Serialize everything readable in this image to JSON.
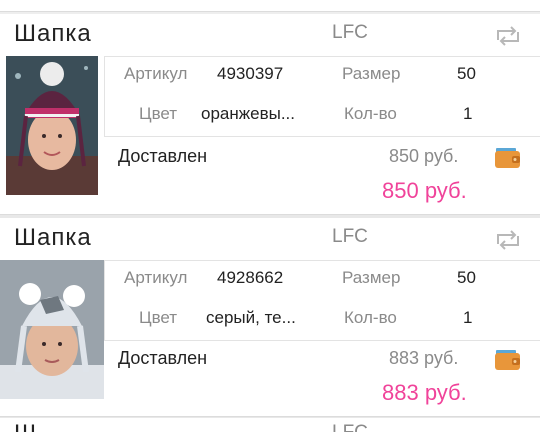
{
  "top_partial": {
    "price_peek": ""
  },
  "labels": {
    "article": "Артикул",
    "size": "Размер",
    "color": "Цвет",
    "qty": "Кол-во"
  },
  "orders": [
    {
      "title": "Шапка",
      "brand": "LFC",
      "article": "4930397",
      "size": "50",
      "color": "оранжевы...",
      "qty": "1",
      "status": "Доставлен",
      "price": "850 руб.",
      "total": "850 руб.",
      "icons": [
        "repeat-order-icon",
        "wallet-icon"
      ]
    },
    {
      "title": "Шапка",
      "brand": "LFC",
      "article": "4928662",
      "size": "50",
      "color": "серый, те...",
      "qty": "1",
      "status": "Доставлен",
      "price": "883 руб.",
      "total": "883 руб.",
      "icons": [
        "repeat-order-icon",
        "wallet-icon"
      ]
    }
  ],
  "bottom_partial": {
    "title": "Ш",
    "brand": "LFC"
  },
  "colors": {
    "accent_pink": "#f0439a",
    "muted_text": "#8a8a8a",
    "wallet_orange": "#e8963a"
  }
}
